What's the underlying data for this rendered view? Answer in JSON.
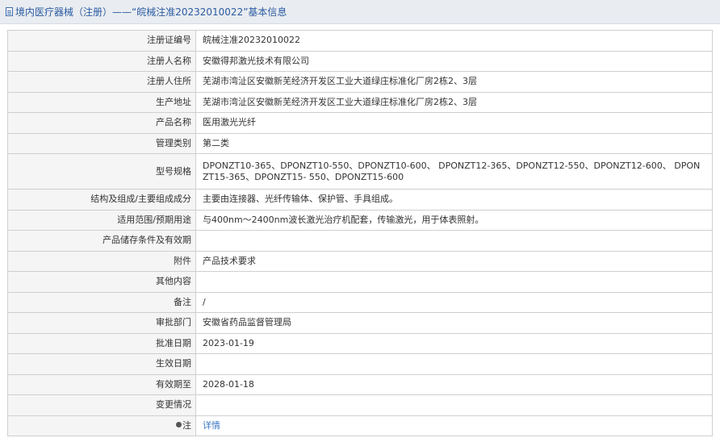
{
  "header": {
    "title": "境内医疗器械（注册）——“皖械注准20232010022”基本信息",
    "icon": "document-icon"
  },
  "rows": [
    {
      "label": "注册证编号",
      "value": "皖械注准20232010022"
    },
    {
      "label": "注册人名称",
      "value": "安徽得邦激光技术有限公司"
    },
    {
      "label": "注册人住所",
      "value": "芜湖市湾沚区安徽新芜经济开发区工业大道绿庄标准化厂房2栋2、3层"
    },
    {
      "label": "生产地址",
      "value": "芜湖市湾沚区安徽新芜经济开发区工业大道绿庄标准化厂房2栋2、3层"
    },
    {
      "label": "产品名称",
      "value": "医用激光光纤"
    },
    {
      "label": "管理类别",
      "value": "第二类"
    },
    {
      "label": "型号规格",
      "value": "DPONZT10-365、DPONZT10-550、DPONZT10-600、 DPONZT12-365、DPONZT12-550、DPONZT12-600、 DPONZT15-365、DPONZT15- 550、DPONZT15-600"
    },
    {
      "label": "结构及组成/主要组成成分",
      "value": "主要由连接器、光纤传输体、保护管、手具组成。"
    },
    {
      "label": "适用范围/预期用途",
      "value": "与400nm～2400nm波长激光治疗机配套，传输激光，用于体表照射。"
    },
    {
      "label": "产品储存条件及有效期",
      "value": ""
    },
    {
      "label": "附件",
      "value": "产品技术要求"
    },
    {
      "label": "其他内容",
      "value": ""
    },
    {
      "label": "备注",
      "value": "/"
    },
    {
      "label": "审批部门",
      "value": "安徽省药品监督管理局"
    },
    {
      "label": "批准日期",
      "value": "2023-01-19"
    },
    {
      "label": "生效日期",
      "value": ""
    },
    {
      "label": "有效期至",
      "value": "2028-01-18"
    },
    {
      "label": "变更情况",
      "value": ""
    }
  ],
  "note_row": {
    "label": "注",
    "icon": "pin-icon",
    "link_text": "详情"
  },
  "colors": {
    "header_bg": "#e9ecf0",
    "title": "#2b5ba3",
    "label_bg": "#f5f5f5",
    "border": "#cfcfcf",
    "link": "#3a76c4"
  }
}
